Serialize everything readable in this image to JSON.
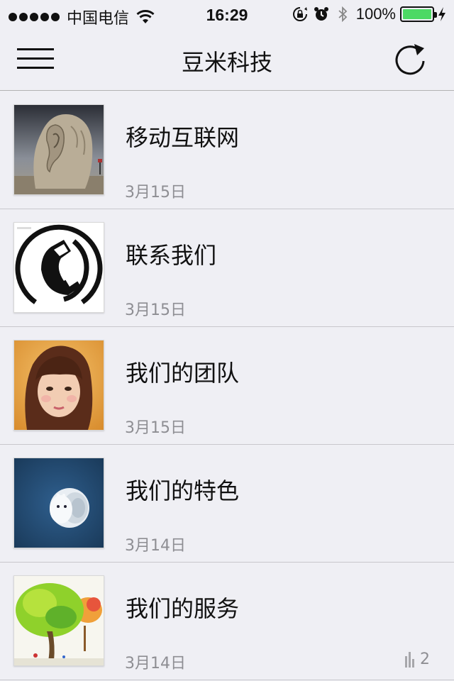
{
  "status_bar": {
    "carrier": "中国电信",
    "time": "16:29",
    "battery_percent": "100%",
    "icons": [
      "signal-dots",
      "wifi-icon",
      "rotation-lock-icon",
      "alarm-icon",
      "bluetooth-icon",
      "battery-icon",
      "charging-icon"
    ]
  },
  "navbar": {
    "title": "豆米科技",
    "left_icon": "menu-icon",
    "right_icon": "refresh-icon"
  },
  "list": {
    "items": [
      {
        "title": "移动互联网",
        "date": "3月15日",
        "thumb": "sculpture-ear-image"
      },
      {
        "title": "联系我们",
        "date": "3月15日",
        "thumb": "phone-logo-image"
      },
      {
        "title": "我们的团队",
        "date": "3月15日",
        "thumb": "portrait-image"
      },
      {
        "title": "我们的特色",
        "date": "3月14日",
        "thumb": "toy-character-image"
      },
      {
        "title": "我们的服务",
        "date": "3月14日",
        "thumb": "tree-painting-image",
        "count": "2",
        "count_icon": "bar-chart-icon"
      }
    ]
  },
  "colors": {
    "background": "#efeff4",
    "battery": "#4cd964",
    "secondary_text": "#8e8e93"
  }
}
